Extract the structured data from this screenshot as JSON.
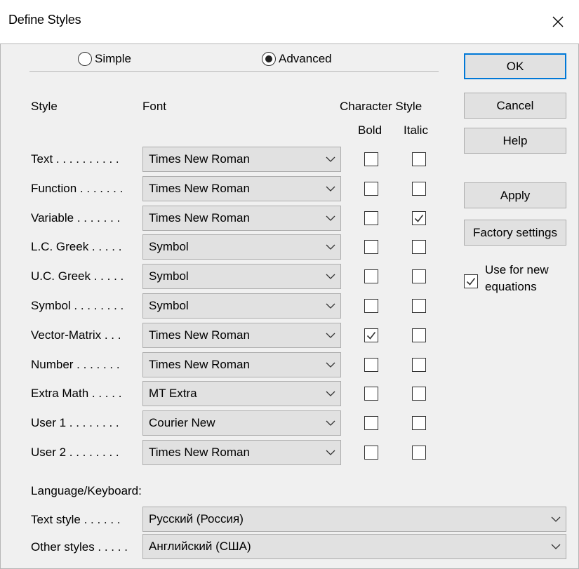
{
  "window": {
    "title": "Define Styles"
  },
  "mode": {
    "simple_label": "Simple",
    "advanced_label": "Advanced",
    "selected": "Advanced"
  },
  "headers": {
    "style": "Style",
    "font": "Font",
    "character_style": "Character Style",
    "bold": "Bold",
    "italic": "Italic"
  },
  "styles": [
    {
      "label": "Text . . . . . . . . . .",
      "font": "Times New Roman",
      "bold": false,
      "italic": false
    },
    {
      "label": "Function . . . . . . .",
      "font": "Times New Roman",
      "bold": false,
      "italic": false
    },
    {
      "label": "Variable . . . . . . .",
      "font": "Times New Roman",
      "bold": false,
      "italic": true
    },
    {
      "label": "L.C. Greek . . . . .",
      "font": "Symbol",
      "bold": false,
      "italic": false
    },
    {
      "label": "U.C. Greek . . . . .",
      "font": "Symbol",
      "bold": false,
      "italic": false
    },
    {
      "label": "Symbol . . . . . . . .",
      "font": "Symbol",
      "bold": false,
      "italic": false
    },
    {
      "label": "Vector-Matrix . . .",
      "font": "Times New Roman",
      "bold": true,
      "italic": false
    },
    {
      "label": "Number . . . . . . .",
      "font": "Times New Roman",
      "bold": false,
      "italic": false
    },
    {
      "label": "Extra Math . . . . .",
      "font": "MT Extra",
      "bold": false,
      "italic": false
    },
    {
      "label": "User 1 . . . . . . . .",
      "font": "Courier New",
      "bold": false,
      "italic": false
    },
    {
      "label": "User 2 . . . . . . . .",
      "font": "Times New Roman",
      "bold": false,
      "italic": false
    }
  ],
  "buttons": {
    "ok": "OK",
    "cancel": "Cancel",
    "help": "Help",
    "apply": "Apply",
    "factory": "Factory settings"
  },
  "use_for_new": {
    "line1": "Use for new",
    "line2": "equations",
    "checked": true
  },
  "language": {
    "heading": "Language/Keyboard:",
    "text_style_label": "Text style . . . . . .",
    "text_style_value": "Русский (Россия)",
    "other_styles_label": "Other styles . . . . .",
    "other_styles_value": "Английский (США)"
  }
}
